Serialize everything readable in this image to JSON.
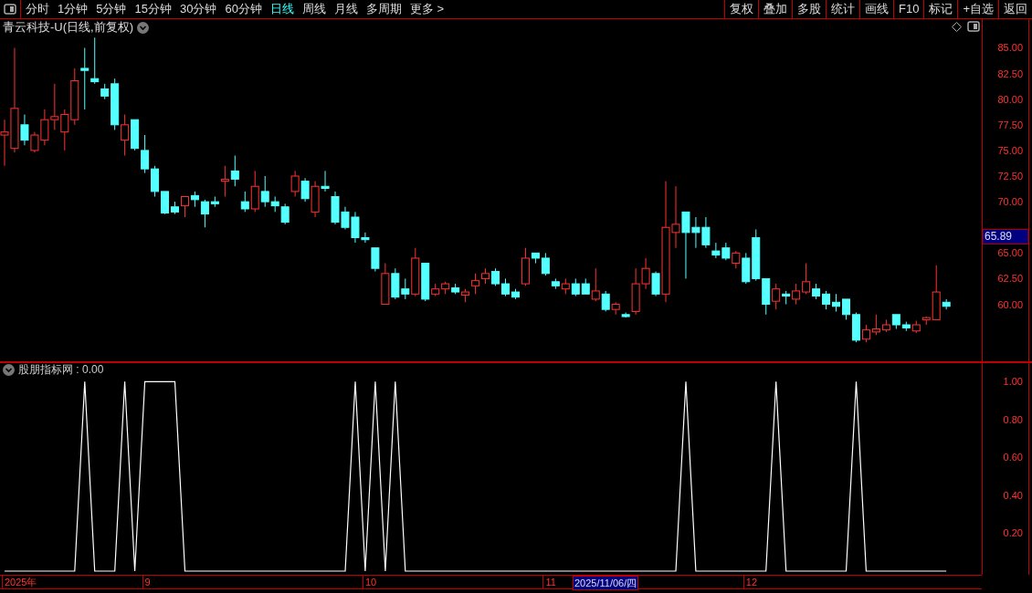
{
  "toolbar": {
    "periods": [
      {
        "label": "分时",
        "selected": false
      },
      {
        "label": "1分钟",
        "selected": false
      },
      {
        "label": "5分钟",
        "selected": false
      },
      {
        "label": "15分钟",
        "selected": false
      },
      {
        "label": "30分钟",
        "selected": false
      },
      {
        "label": "60分钟",
        "selected": false
      },
      {
        "label": "日线",
        "selected": true
      },
      {
        "label": "周线",
        "selected": false
      },
      {
        "label": "月线",
        "selected": false
      },
      {
        "label": "多周期",
        "selected": false
      },
      {
        "label": "更多 >",
        "selected": false
      }
    ],
    "actions": [
      "复权",
      "叠加",
      "多股",
      "统计",
      "画线",
      "F10",
      "标记",
      "+自选",
      "返回"
    ]
  },
  "price_chart": {
    "title": "青云科技-U(日线,前复权)",
    "cursor_price": "65.89",
    "date_axis": {
      "labels": [
        "2025年",
        "9",
        "10",
        "11",
        "12"
      ],
      "crosshair_label": "2025/11/06/四"
    },
    "chart_data": {
      "type": "candlestick",
      "ylim": [
        54.4,
        87.8
      ],
      "yticks": [
        {
          "value": 85,
          "label": "85.00"
        },
        {
          "value": 82.5,
          "label": "82.50"
        },
        {
          "value": 80,
          "label": "80.00"
        },
        {
          "value": 77.5,
          "label": "77.50"
        },
        {
          "value": 75,
          "label": "75.00"
        },
        {
          "value": 72.5,
          "label": "72.50"
        },
        {
          "value": 70,
          "label": "70.00"
        },
        {
          "value": 65,
          "label": "65.00"
        },
        {
          "value": 62.5,
          "label": "62.50"
        },
        {
          "value": 60,
          "label": "60.00"
        }
      ],
      "ohlc": [
        [
          76.5,
          78.0,
          73.5,
          76.8
        ],
        [
          75.2,
          85.0,
          74.8,
          79.1
        ],
        [
          77.5,
          78.5,
          75.5,
          76.0
        ],
        [
          75.0,
          76.8,
          74.8,
          76.5
        ],
        [
          76.0,
          79.0,
          75.5,
          78.0
        ],
        [
          78.0,
          81.5,
          77.0,
          78.3
        ],
        [
          76.8,
          79.0,
          75.0,
          78.5
        ],
        [
          78.0,
          83.0,
          77.5,
          81.8
        ],
        [
          83.0,
          85.0,
          79.0,
          82.8
        ],
        [
          82.0,
          86.0,
          81.5,
          81.7
        ],
        [
          81.0,
          81.5,
          80.0,
          80.3
        ],
        [
          81.5,
          82.0,
          77.0,
          77.5
        ],
        [
          76.0,
          78.5,
          74.5,
          77.5
        ],
        [
          78.0,
          78.0,
          75.0,
          75.2
        ],
        [
          75.0,
          76.5,
          72.8,
          73.2
        ],
        [
          73.2,
          73.5,
          70.5,
          71.0
        ],
        [
          71.0,
          71.0,
          68.8,
          68.9
        ],
        [
          69.5,
          70.0,
          68.8,
          69.0
        ],
        [
          69.6,
          70.5,
          68.5,
          70.5
        ],
        [
          70.6,
          71.0,
          69.5,
          70.2
        ],
        [
          70.0,
          70.2,
          67.5,
          68.8
        ],
        [
          70.0,
          70.5,
          69.5,
          69.8
        ],
        [
          72.0,
          73.5,
          70.5,
          72.2
        ],
        [
          73.0,
          74.5,
          71.5,
          72.2
        ],
        [
          70.0,
          71.0,
          69.0,
          69.3
        ],
        [
          69.3,
          73.0,
          69.0,
          71.5
        ],
        [
          71.0,
          72.5,
          69.5,
          70.0
        ],
        [
          70.0,
          70.5,
          69.0,
          69.6
        ],
        [
          69.5,
          69.8,
          67.8,
          68.0
        ],
        [
          71.0,
          73.0,
          70.5,
          72.5
        ],
        [
          72.0,
          72.3,
          70.0,
          70.3
        ],
        [
          69.0,
          72.0,
          68.5,
          71.5
        ],
        [
          71.5,
          73.0,
          71.0,
          71.3
        ],
        [
          70.5,
          71.0,
          67.8,
          68.0
        ],
        [
          69.0,
          69.5,
          67.3,
          67.5
        ],
        [
          68.5,
          69.0,
          66.0,
          66.5
        ],
        [
          66.5,
          67.0,
          66.0,
          66.3
        ],
        [
          65.5,
          65.5,
          63.2,
          63.5
        ],
        [
          60.0,
          64.0,
          60.0,
          63.0
        ],
        [
          63.0,
          63.5,
          60.5,
          60.7
        ],
        [
          61.5,
          62.5,
          60.5,
          61.0
        ],
        [
          61.0,
          65.5,
          60.8,
          64.5
        ],
        [
          64.0,
          64.0,
          60.3,
          60.5
        ],
        [
          61.0,
          62.0,
          60.8,
          61.5
        ],
        [
          61.5,
          62.2,
          61.0,
          62.0
        ],
        [
          61.6,
          62.0,
          61.0,
          61.2
        ],
        [
          60.9,
          61.5,
          60.2,
          61.2
        ],
        [
          61.8,
          63.0,
          61.0,
          62.3
        ],
        [
          62.5,
          63.5,
          62.0,
          63.0
        ],
        [
          63.2,
          63.5,
          61.8,
          62.0
        ],
        [
          62.0,
          62.5,
          60.8,
          61.0
        ],
        [
          61.2,
          61.5,
          60.5,
          60.7
        ],
        [
          62.0,
          65.5,
          61.8,
          64.5
        ],
        [
          65.0,
          65.0,
          64.0,
          64.5
        ],
        [
          64.5,
          65.0,
          62.8,
          63.0
        ],
        [
          62.2,
          62.5,
          61.5,
          61.8
        ],
        [
          61.5,
          62.5,
          61.0,
          62.0
        ],
        [
          62.0,
          62.5,
          60.8,
          61.0
        ],
        [
          62.0,
          62.5,
          61.0,
          61.0
        ],
        [
          60.5,
          63.5,
          60.3,
          61.3
        ],
        [
          61.0,
          61.3,
          59.3,
          59.5
        ],
        [
          59.5,
          60.2,
          59.0,
          60.0
        ],
        [
          59.0,
          59.2,
          58.7,
          58.8
        ],
        [
          59.3,
          63.5,
          59.0,
          62.0
        ],
        [
          62.0,
          64.5,
          61.5,
          63.5
        ],
        [
          63.0,
          63.2,
          60.8,
          61.0
        ],
        [
          61.0,
          72.0,
          60.2,
          67.5
        ],
        [
          67.0,
          71.5,
          65.5,
          67.8
        ],
        [
          69.0,
          69.0,
          62.5,
          67.0
        ],
        [
          67.5,
          68.5,
          65.5,
          67.0
        ],
        [
          67.5,
          68.5,
          65.5,
          65.8
        ],
        [
          65.2,
          66.0,
          64.5,
          64.8
        ],
        [
          65.5,
          66.0,
          64.3,
          64.5
        ],
        [
          64.0,
          65.2,
          63.5,
          65.0
        ],
        [
          64.5,
          65.0,
          62.0,
          62.2
        ],
        [
          66.5,
          67.3,
          62.3,
          62.5
        ],
        [
          62.5,
          62.5,
          59.0,
          60.0
        ],
        [
          60.3,
          62.0,
          59.5,
          61.5
        ],
        [
          61.0,
          61.3,
          60.0,
          60.8
        ],
        [
          60.5,
          62.0,
          60.0,
          61.3
        ],
        [
          61.2,
          64.0,
          61.0,
          62.2
        ],
        [
          61.5,
          62.0,
          60.5,
          60.8
        ],
        [
          61.0,
          61.3,
          59.5,
          60.0
        ],
        [
          60.2,
          61.0,
          59.3,
          59.8
        ],
        [
          60.5,
          60.5,
          58.5,
          59.0
        ],
        [
          59.0,
          59.2,
          56.3,
          56.5
        ],
        [
          56.6,
          58.0,
          56.3,
          57.5
        ],
        [
          57.3,
          59.0,
          57.0,
          57.6
        ],
        [
          57.5,
          58.5,
          57.3,
          58.0
        ],
        [
          59.0,
          59.0,
          57.6,
          58.0
        ],
        [
          58.0,
          58.3,
          57.4,
          57.7
        ],
        [
          57.4,
          58.4,
          57.2,
          58.0
        ],
        [
          58.5,
          58.8,
          58.0,
          58.7
        ],
        [
          58.5,
          63.8,
          58.5,
          61.2
        ],
        [
          60.2,
          60.5,
          59.5,
          59.8
        ]
      ]
    }
  },
  "indicator": {
    "title": "股朋指标网 : 0.00",
    "chart_data": {
      "type": "line",
      "ylim": [
        0,
        1.1
      ],
      "yticks": [
        {
          "value": 1,
          "label": "1.00"
        },
        {
          "value": 0.8,
          "label": "0.80"
        },
        {
          "value": 0.6,
          "label": "0.60"
        },
        {
          "value": 0.4,
          "label": "0.40"
        },
        {
          "value": 0.2,
          "label": "0.20"
        }
      ],
      "series": [
        {
          "color": "#ffffff",
          "values": [
            0,
            0,
            0,
            0,
            0,
            0,
            0,
            0,
            1,
            0,
            0,
            0,
            1,
            0,
            1,
            1,
            1,
            1,
            0,
            0,
            0,
            0,
            0,
            0,
            0,
            0,
            0,
            0,
            0,
            0,
            0,
            0,
            0,
            0,
            0,
            1,
            0,
            1,
            0,
            1,
            0,
            0,
            0,
            0,
            0,
            0,
            0,
            0,
            0,
            0,
            0,
            0,
            0,
            0,
            0,
            0,
            0,
            0,
            0,
            0,
            0,
            0,
            0,
            0,
            0,
            0,
            0,
            0,
            1,
            0,
            0,
            0,
            0,
            0,
            0,
            0,
            0,
            1,
            0,
            0,
            0,
            0,
            0,
            0,
            0,
            1,
            0,
            0,
            0,
            0,
            0,
            0,
            0,
            0,
            0
          ]
        }
      ]
    }
  }
}
